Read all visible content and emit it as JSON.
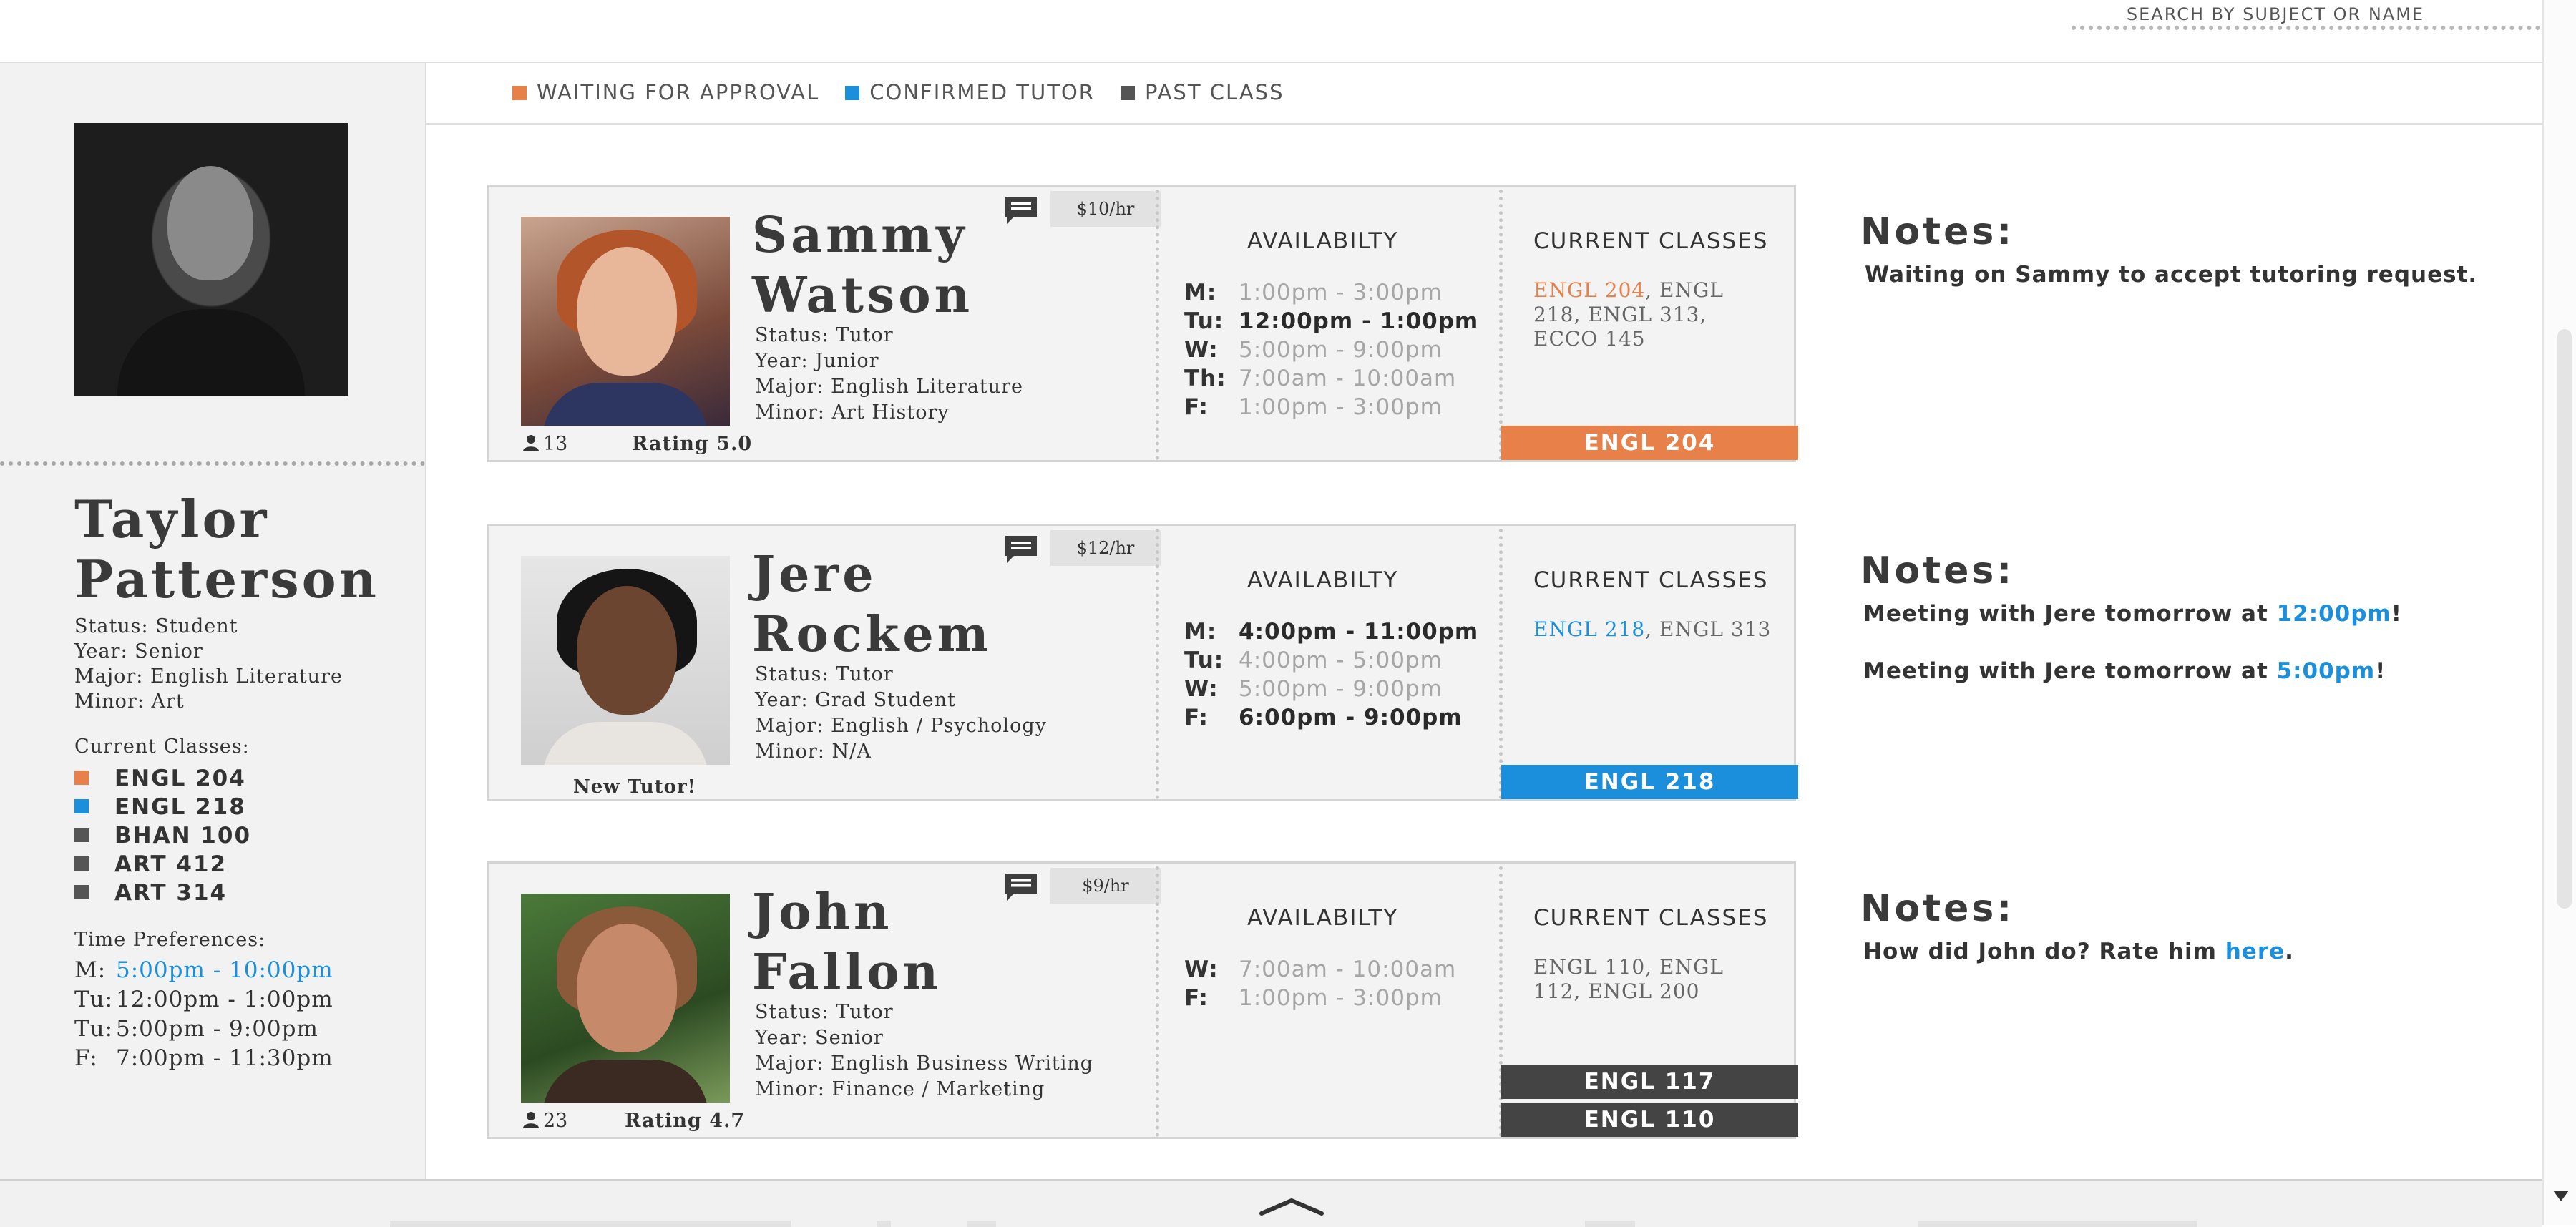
{
  "search": {
    "label": "SEARCH BY SUBJECT OR NAME"
  },
  "colors": {
    "waiting": "#e8804a",
    "confirmed": "#1b8fdc",
    "past": "#555555",
    "text": "#333333"
  },
  "profile": {
    "first_name": "Taylor",
    "last_name": "Patterson",
    "status": "Status: Student",
    "year": "Year: Senior",
    "major": "Major: English Literature",
    "minor": "Minor: Art",
    "classes_title": "Current Classes:",
    "classes": [
      {
        "label": "ENGL 204",
        "state": "waiting"
      },
      {
        "label": "ENGL 218",
        "state": "confirmed"
      },
      {
        "label": "BHAN 100",
        "state": "past"
      },
      {
        "label": "ART 412",
        "state": "past"
      },
      {
        "label": "ART 314",
        "state": "past"
      }
    ],
    "time_title": "Time Preferences:",
    "time_prefs": [
      {
        "day": "M:",
        "time": "5:00pm - 10:00pm",
        "highlight": true
      },
      {
        "day": "Tu:",
        "time": "12:00pm - 1:00pm",
        "highlight": false
      },
      {
        "day": "Tu:",
        "time": "5:00pm - 9:00pm",
        "highlight": false
      },
      {
        "day": "F:",
        "time": "7:00pm - 11:30pm",
        "highlight": false
      }
    ]
  },
  "legend": [
    {
      "label": "WAITING FOR APPROVAL",
      "state": "waiting"
    },
    {
      "label": "CONFIRMED TUTOR",
      "state": "confirmed"
    },
    {
      "label": "PAST CLASS",
      "state": "past"
    }
  ],
  "tutors": [
    {
      "first_name": "Sammy",
      "last_name": "Watson",
      "rate": "$10/hr",
      "status": "Status: Tutor",
      "year": "Year: Junior",
      "major": "Major: English Literature",
      "minor": "Minor: Art History",
      "followers": "13",
      "rating": "Rating 5.0",
      "availability_title": "AVAILABILTY",
      "availability": [
        {
          "day": "M:",
          "time": "1:00pm - 3:00pm",
          "active": false
        },
        {
          "day": "Tu:",
          "time": "12:00pm - 1:00pm",
          "active": true
        },
        {
          "day": "W:",
          "time": "5:00pm - 9:00pm",
          "active": false
        },
        {
          "day": "Th:",
          "time": "7:00am - 10:00am",
          "active": false
        },
        {
          "day": "F:",
          "time": "1:00pm - 3:00pm",
          "active": false
        }
      ],
      "classes_title": "CURRENT CLASSES",
      "classes_highlight": "ENGL 204",
      "classes_rest": ", ENGL 218, ENGL 313, ECCO 145",
      "bars": [
        {
          "label": "ENGL 204",
          "state": "waiting"
        }
      ],
      "notes_title": "Notes:",
      "notes": [
        {
          "pre": "Waiting on Sammy to accept tutoring request.",
          "link": "",
          "post": ""
        }
      ]
    },
    {
      "first_name": "Jere",
      "last_name": "Rockem",
      "rate": "$12/hr",
      "status": "Status: Tutor",
      "year": "Year: Grad Student",
      "major": "Major: English / Psychology",
      "minor": "Minor: N/A",
      "badge": "New Tutor!",
      "availability_title": "AVAILABILTY",
      "availability": [
        {
          "day": "M:",
          "time": "4:00pm - 11:00pm",
          "active": true
        },
        {
          "day": "Tu:",
          "time": "4:00pm - 5:00pm",
          "active": false
        },
        {
          "day": "W:",
          "time": "5:00pm - 9:00pm",
          "active": false
        },
        {
          "day": "F:",
          "time": "6:00pm - 9:00pm",
          "active": true
        }
      ],
      "classes_title": "CURRENT CLASSES",
      "classes_highlight": "ENGL 218",
      "classes_rest": ", ENGL 313",
      "bars": [
        {
          "label": "ENGL 218",
          "state": "confirmed"
        }
      ],
      "notes_title": "Notes:",
      "notes": [
        {
          "pre": "Meeting with Jere tomorrow at ",
          "link": "12:00pm",
          "post": "!"
        },
        {
          "pre": "Meeting with Jere tomorrow at ",
          "link": "5:00pm",
          "post": "!"
        }
      ]
    },
    {
      "first_name": "John",
      "last_name": "Fallon",
      "rate": "$9/hr",
      "status": "Status: Tutor",
      "year": "Year: Senior",
      "major": "Major: English Business Writing",
      "minor": "Minor: Finance / Marketing",
      "followers": "23",
      "rating": "Rating 4.7",
      "availability_title": "AVAILABILTY",
      "availability": [
        {
          "day": "W:",
          "time": "7:00am - 10:00am",
          "active": false
        },
        {
          "day": "F:",
          "time": "1:00pm - 3:00pm",
          "active": false
        }
      ],
      "classes_title": "CURRENT CLASSES",
      "classes_highlight": "",
      "classes_rest": "ENGL 110, ENGL 112, ENGL 200",
      "bars": [
        {
          "label": "ENGL 117",
          "state": "past"
        },
        {
          "label": "ENGL 110",
          "state": "past"
        }
      ],
      "notes_title": "Notes:",
      "notes": [
        {
          "pre": "How did John do? Rate him ",
          "link": "here",
          "post": "."
        }
      ]
    }
  ],
  "icons": {
    "chat": "chat-bubble-icon",
    "person": "person-icon",
    "scroll_up": "chevron-up-icon",
    "scroll_down": "arrow-down-icon"
  }
}
